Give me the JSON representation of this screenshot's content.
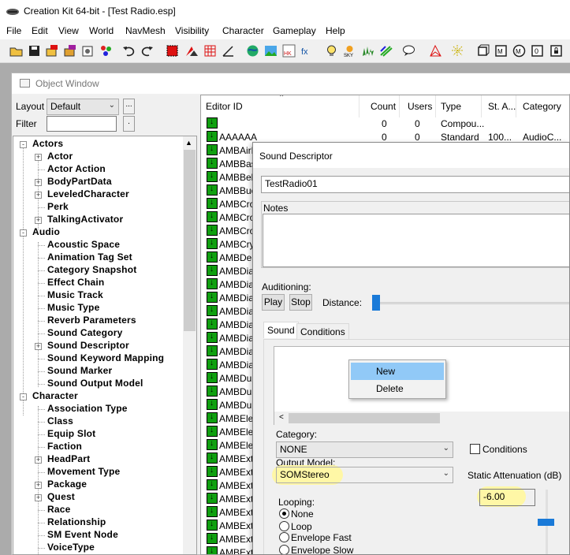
{
  "app": {
    "title": "Creation Kit 64-bit - [Test Radio.esp]"
  },
  "menu": [
    "File",
    "Edit",
    "View",
    "World",
    "NavMesh",
    "Visibility",
    "Character",
    "Gameplay",
    "Help"
  ],
  "object_window": {
    "title": "Object Window",
    "layout_label": "Layout",
    "layout_value": "Default",
    "filter_label": "Filter",
    "filter_value": "",
    "ellipsis": "...",
    "dot": "."
  },
  "tree": [
    {
      "label": "Actors",
      "level": 0,
      "exp": "-"
    },
    {
      "label": "Actor",
      "level": 1,
      "exp": "+"
    },
    {
      "label": "Actor Action",
      "level": 1,
      "exp": ""
    },
    {
      "label": "BodyPartData",
      "level": 1,
      "exp": "+"
    },
    {
      "label": "LeveledCharacter",
      "level": 1,
      "exp": "+"
    },
    {
      "label": "Perk",
      "level": 1,
      "exp": ""
    },
    {
      "label": "TalkingActivator",
      "level": 1,
      "exp": "+"
    },
    {
      "label": "Audio",
      "level": 0,
      "exp": "-"
    },
    {
      "label": "Acoustic Space",
      "level": 1,
      "exp": ""
    },
    {
      "label": "Animation Tag Set",
      "level": 1,
      "exp": ""
    },
    {
      "label": "Category Snapshot",
      "level": 1,
      "exp": ""
    },
    {
      "label": "Effect Chain",
      "level": 1,
      "exp": ""
    },
    {
      "label": "Music Track",
      "level": 1,
      "exp": ""
    },
    {
      "label": "Music Type",
      "level": 1,
      "exp": ""
    },
    {
      "label": "Reverb Parameters",
      "level": 1,
      "exp": ""
    },
    {
      "label": "Sound Category",
      "level": 1,
      "exp": ""
    },
    {
      "label": "Sound Descriptor",
      "level": 1,
      "exp": "+"
    },
    {
      "label": "Sound Keyword Mapping",
      "level": 1,
      "exp": ""
    },
    {
      "label": "Sound Marker",
      "level": 1,
      "exp": ""
    },
    {
      "label": "Sound Output Model",
      "level": 1,
      "exp": ""
    },
    {
      "label": "Character",
      "level": 0,
      "exp": "-"
    },
    {
      "label": "Association Type",
      "level": 1,
      "exp": ""
    },
    {
      "label": "Class",
      "level": 1,
      "exp": ""
    },
    {
      "label": "Equip Slot",
      "level": 1,
      "exp": ""
    },
    {
      "label": "Faction",
      "level": 1,
      "exp": ""
    },
    {
      "label": "HeadPart",
      "level": 1,
      "exp": "+"
    },
    {
      "label": "Movement Type",
      "level": 1,
      "exp": ""
    },
    {
      "label": "Package",
      "level": 1,
      "exp": "+"
    },
    {
      "label": "Quest",
      "level": 1,
      "exp": "+"
    },
    {
      "label": "Race",
      "level": 1,
      "exp": ""
    },
    {
      "label": "Relationship",
      "level": 1,
      "exp": ""
    },
    {
      "label": "SM Event Node",
      "level": 1,
      "exp": ""
    },
    {
      "label": "VoiceType",
      "level": 1,
      "exp": ""
    }
  ],
  "list": {
    "columns": [
      "Editor ID",
      "Count",
      "Users",
      "Type",
      "St. A...",
      "Category"
    ],
    "rows": [
      {
        "id": "",
        "count": "0",
        "users": "0",
        "type": "Compou...",
        "sta": "",
        "cat": ""
      },
      {
        "id": "AAAAAA",
        "count": "0",
        "users": "0",
        "type": "Standard",
        "sta": "100...",
        "cat": "AudioC..."
      },
      {
        "id": "AMBAirR"
      },
      {
        "id": "AMBBas"
      },
      {
        "id": "AMBBell"
      },
      {
        "id": "AMBBuo"
      },
      {
        "id": "AMBCrow"
      },
      {
        "id": "AMBCrow"
      },
      {
        "id": "AMBCrow"
      },
      {
        "id": "AMBCryo"
      },
      {
        "id": "AMBDea"
      },
      {
        "id": "AMBDian"
      },
      {
        "id": "AMBDian"
      },
      {
        "id": "AMBDian"
      },
      {
        "id": "AMBDian"
      },
      {
        "id": "AMBDian"
      },
      {
        "id": "AMBDian"
      },
      {
        "id": "AMBDian"
      },
      {
        "id": "AMBDian"
      },
      {
        "id": "AMBDun"
      },
      {
        "id": "AMBDun"
      },
      {
        "id": "AMBDun"
      },
      {
        "id": "AMBElec"
      },
      {
        "id": "AMBElec"
      },
      {
        "id": "AMBElev"
      },
      {
        "id": "AMBExtF"
      },
      {
        "id": "AMBExtF"
      },
      {
        "id": "AMBExtF"
      },
      {
        "id": "AMBExtF"
      },
      {
        "id": "AMBExtF"
      },
      {
        "id": "AMBExtF"
      },
      {
        "id": "AMBExtF"
      },
      {
        "id": "AMBExtF"
      }
    ]
  },
  "sound_descriptor": {
    "title": "Sound Descriptor",
    "editor_id": "TestRadio01",
    "notes_label": "Notes",
    "auditioning_label": "Auditioning:",
    "play": "Play",
    "stop": "Stop",
    "distance_label": "Distance:",
    "distance_level": 0.0,
    "tabs": [
      "Sound",
      "Conditions"
    ],
    "category_label": "Category:",
    "category_value": "NONE",
    "conditions_checkbox": "Conditions",
    "output_model_label": "Output Model:",
    "output_model_value": "SOMStereo",
    "static_attenuation_label": "Static Attenuation (dB)",
    "static_attenuation_value": "-6.00",
    "looping_label": "Looping:",
    "looping_options": [
      "None",
      "Loop",
      "Envelope Fast",
      "Envelope Slow"
    ],
    "looping_selected": "None"
  },
  "context_menu": {
    "items": [
      "New",
      "Delete"
    ],
    "highlighted": "New"
  },
  "colors": {
    "highlight": "#fff7a6",
    "menu_selection": "#91c9f7",
    "record_icon": "#10a010"
  }
}
